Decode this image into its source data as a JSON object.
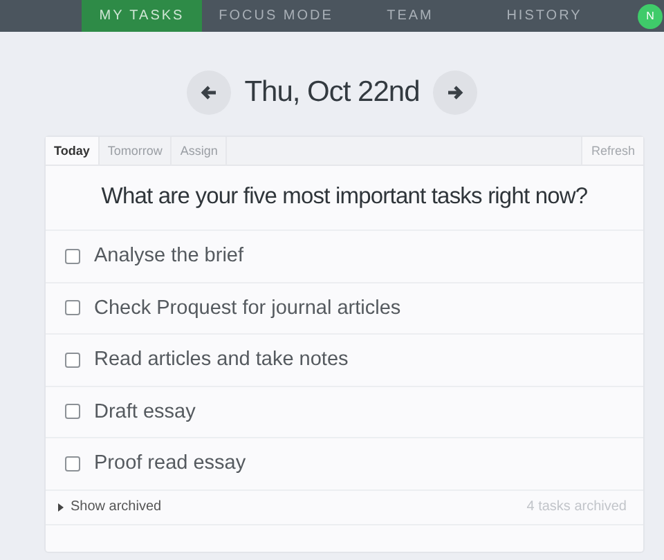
{
  "nav": {
    "tabs": [
      {
        "label": "MY TASKS",
        "selected": true
      },
      {
        "label": "FOCUS MODE",
        "selected": false
      },
      {
        "label": "TEAM",
        "selected": false
      },
      {
        "label": "HISTORY",
        "selected": false
      }
    ],
    "avatar": "N"
  },
  "date": "Thu, Oct 22nd",
  "card": {
    "tabs": [
      {
        "label": "Today",
        "selected": true
      },
      {
        "label": "Tomorrow",
        "selected": false
      },
      {
        "label": "Assign",
        "selected": false
      }
    ],
    "refresh": "Refresh",
    "question": "What are your five most important tasks right now?",
    "tasks": [
      {
        "text": "Analyse the brief",
        "checked": false
      },
      {
        "text": "Check Proquest for journal articles",
        "checked": false
      },
      {
        "text": "Read articles and take notes",
        "checked": false
      },
      {
        "text": "Draft essay",
        "checked": false
      },
      {
        "text": "Proof read essay",
        "checked": false
      }
    ],
    "show_archived": "Show archived",
    "archived_count": "4 tasks archived"
  }
}
